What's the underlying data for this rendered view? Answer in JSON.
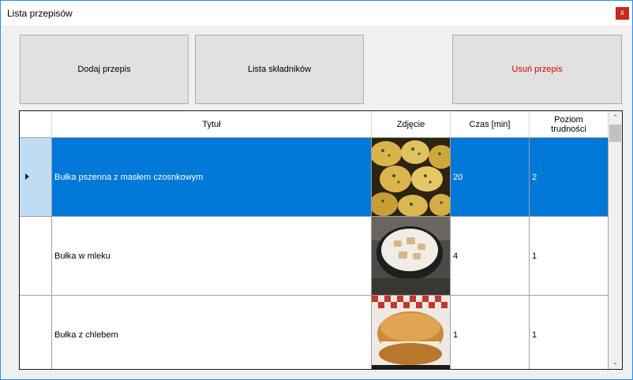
{
  "window": {
    "title": "Lista przepisów",
    "close_glyph": "x"
  },
  "toolbar": {
    "add_label": "Dodaj przepis",
    "ingredients_label": "Lista składników",
    "delete_label": "Usuń przepis"
  },
  "grid": {
    "columns": {
      "title": "Tytuł",
      "image": "Zdjęcie",
      "time": "Czas [min]",
      "difficulty_line1": "Poziom",
      "difficulty_line2": "trudności"
    },
    "rows": [
      {
        "title": "Bułka pszenna z masłem czosnkowym",
        "image": "garlic-buns-photo",
        "time": "20",
        "difficulty": "2",
        "selected": true
      },
      {
        "title": "Bułka w mleku",
        "image": "bun-in-milk-photo",
        "time": "4",
        "difficulty": "1",
        "selected": false
      },
      {
        "title": "Bułka z chlebem",
        "image": "bun-with-bread-photo",
        "time": "1",
        "difficulty": "1",
        "selected": false
      }
    ]
  },
  "scrollbar": {
    "up_glyph": "⌃",
    "down_glyph": "⌄"
  },
  "colors": {
    "selection": "#0078d7",
    "row_header_selected": "#c0dcf3",
    "delete_text": "#e00000",
    "close_button": "#c42b1c"
  }
}
